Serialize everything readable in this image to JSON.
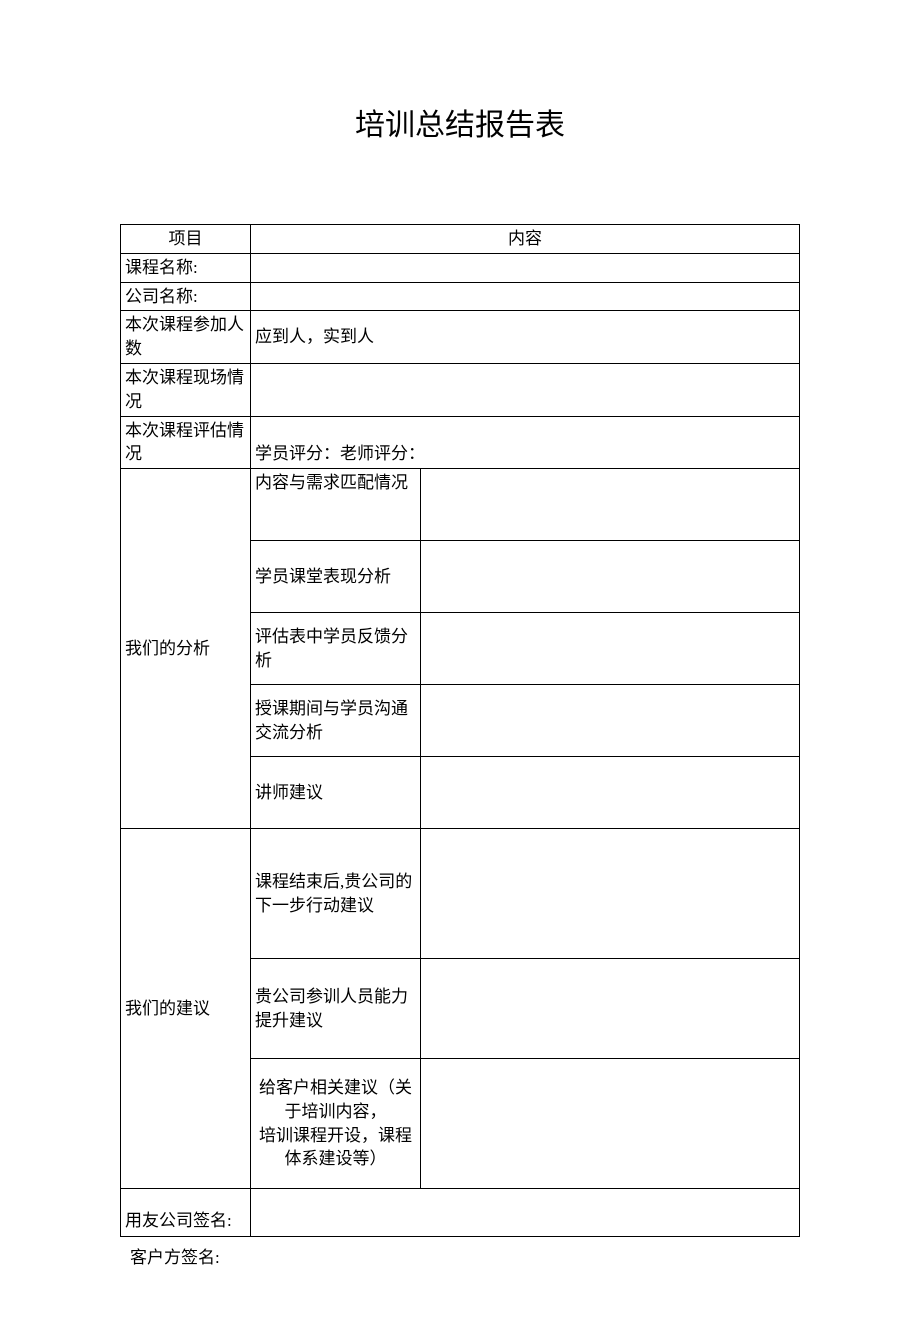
{
  "title": "培训总结报告表",
  "header": {
    "col1": "项目",
    "col2": "内容"
  },
  "rows": {
    "courseName": "课程名称:",
    "companyName": "公司名称:",
    "attendees": {
      "label": "本次课程参加人数",
      "value": "应到人，实到人"
    },
    "onsite": "本次课程现场情况",
    "evaluation": {
      "label": "本次课程评估情况",
      "value": "学员评分：老师评分："
    },
    "analysis": {
      "label": "我们的分析",
      "items": [
        "内容与需求匹配情况",
        "学员课堂表现分析",
        "评估表中学员反馈分析",
        "授课期间与学员沟通交流分析",
        "讲师建议"
      ]
    },
    "suggestions": {
      "label": "我们的建议",
      "items": [
        "课程结束后,贵公司的下一步行动建议",
        "贵公司参训人员能力提升建议",
        "给客户相关建议（关于培训内容，\n培训课程开设，课程体系建设等）"
      ]
    },
    "signature": "用友公司签名:"
  },
  "footer": "客户方签名:"
}
